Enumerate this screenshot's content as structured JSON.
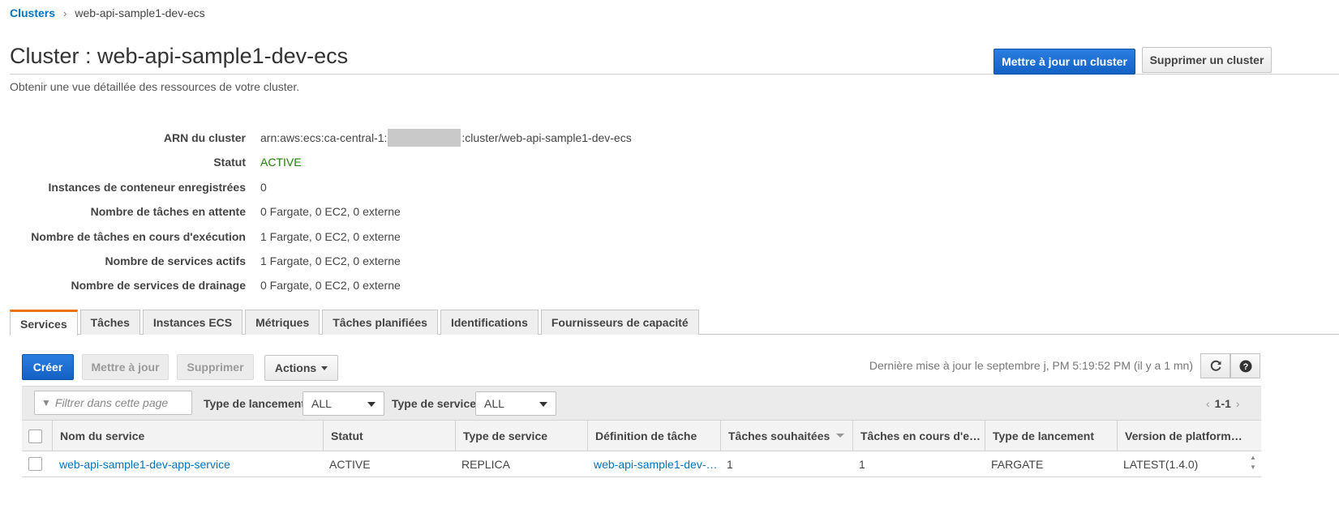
{
  "breadcrumb": {
    "root": "Clusters",
    "current": "web-api-sample1-dev-ecs"
  },
  "header": {
    "title": "Cluster : web-api-sample1-dev-ecs",
    "subtitle": "Obtenir une vue détaillée des ressources de votre cluster.",
    "update_button": "Mettre à jour un cluster",
    "delete_button": "Supprimer un cluster"
  },
  "details": {
    "arn_label": "ARN du cluster",
    "arn_prefix": "arn:aws:ecs:ca-central-1:",
    "arn_suffix": ":cluster/web-api-sample1-dev-ecs",
    "status_label": "Statut",
    "status_value": "ACTIVE",
    "instances_label": "Instances de conteneur enregistrées",
    "instances_value": "0",
    "pending_label": "Nombre de tâches en attente",
    "pending_value": "0 Fargate, 0 EC2, 0 externe",
    "running_label": "Nombre de tâches en cours d'exécution",
    "running_value": "1 Fargate, 0 EC2, 0 externe",
    "active_services_label": "Nombre de services actifs",
    "active_services_value": "1 Fargate, 0 EC2, 0 externe",
    "draining_label": "Nombre de services de drainage",
    "draining_value": "0 Fargate, 0 EC2, 0 externe"
  },
  "tabs": [
    {
      "label": "Services"
    },
    {
      "label": "Tâches"
    },
    {
      "label": "Instances ECS"
    },
    {
      "label": "Métriques"
    },
    {
      "label": "Tâches planifiées"
    },
    {
      "label": "Identifications"
    },
    {
      "label": "Fournisseurs de capacité"
    }
  ],
  "toolbar": {
    "create": "Créer",
    "update": "Mettre à jour",
    "delete": "Supprimer",
    "actions": "Actions",
    "last_updated": "Dernière mise à jour le septembre j, PM 5:19:52 PM (il y a 1 mn)"
  },
  "filters": {
    "search_placeholder": "Filtrer dans cette page",
    "launch_type_label": "Type de lancement",
    "launch_type_value": "ALL",
    "service_type_label": "Type de service",
    "service_type_value": "ALL",
    "pagination": "1-1"
  },
  "table": {
    "columns": [
      "Nom du service",
      "Statut",
      "Type de service",
      "Définition de tâche",
      "Tâches souhaitées",
      "Tâches en cours d'e…",
      "Type de lancement",
      "Version de platform…"
    ],
    "rows": [
      {
        "service_name": "web-api-sample1-dev-app-service",
        "status": "ACTIVE",
        "service_type": "REPLICA",
        "task_definition": "web-api-sample1-dev-…",
        "desired_tasks": "1",
        "running_tasks": "1",
        "launch_type": "FARGATE",
        "platform_version": "LATEST(1.4.0)"
      }
    ]
  },
  "colors": {
    "primary": "#1a6fd1",
    "link": "#0073bb",
    "active": "#1d8102",
    "tab_accent": "#ec7211"
  },
  "icons": {
    "refresh": "refresh-icon",
    "help": "help-icon",
    "filter": "filter-icon"
  }
}
